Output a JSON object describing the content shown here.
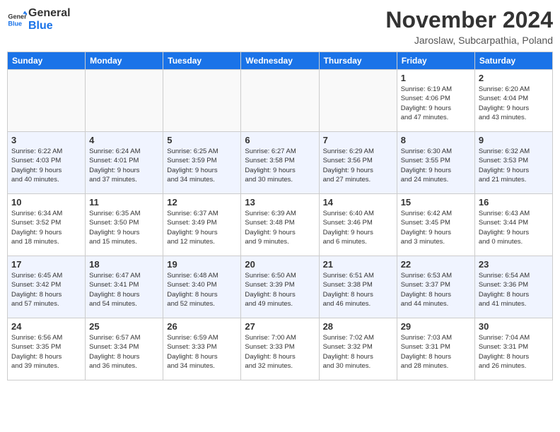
{
  "header": {
    "logo_line1": "General",
    "logo_line2": "Blue",
    "month": "November 2024",
    "location": "Jaroslaw, Subcarpathia, Poland"
  },
  "weekdays": [
    "Sunday",
    "Monday",
    "Tuesday",
    "Wednesday",
    "Thursday",
    "Friday",
    "Saturday"
  ],
  "weeks": [
    {
      "alt": false,
      "days": [
        {
          "num": "",
          "info": ""
        },
        {
          "num": "",
          "info": ""
        },
        {
          "num": "",
          "info": ""
        },
        {
          "num": "",
          "info": ""
        },
        {
          "num": "",
          "info": ""
        },
        {
          "num": "1",
          "info": "Sunrise: 6:19 AM\nSunset: 4:06 PM\nDaylight: 9 hours\nand 47 minutes."
        },
        {
          "num": "2",
          "info": "Sunrise: 6:20 AM\nSunset: 4:04 PM\nDaylight: 9 hours\nand 43 minutes."
        }
      ]
    },
    {
      "alt": true,
      "days": [
        {
          "num": "3",
          "info": "Sunrise: 6:22 AM\nSunset: 4:03 PM\nDaylight: 9 hours\nand 40 minutes."
        },
        {
          "num": "4",
          "info": "Sunrise: 6:24 AM\nSunset: 4:01 PM\nDaylight: 9 hours\nand 37 minutes."
        },
        {
          "num": "5",
          "info": "Sunrise: 6:25 AM\nSunset: 3:59 PM\nDaylight: 9 hours\nand 34 minutes."
        },
        {
          "num": "6",
          "info": "Sunrise: 6:27 AM\nSunset: 3:58 PM\nDaylight: 9 hours\nand 30 minutes."
        },
        {
          "num": "7",
          "info": "Sunrise: 6:29 AM\nSunset: 3:56 PM\nDaylight: 9 hours\nand 27 minutes."
        },
        {
          "num": "8",
          "info": "Sunrise: 6:30 AM\nSunset: 3:55 PM\nDaylight: 9 hours\nand 24 minutes."
        },
        {
          "num": "9",
          "info": "Sunrise: 6:32 AM\nSunset: 3:53 PM\nDaylight: 9 hours\nand 21 minutes."
        }
      ]
    },
    {
      "alt": false,
      "days": [
        {
          "num": "10",
          "info": "Sunrise: 6:34 AM\nSunset: 3:52 PM\nDaylight: 9 hours\nand 18 minutes."
        },
        {
          "num": "11",
          "info": "Sunrise: 6:35 AM\nSunset: 3:50 PM\nDaylight: 9 hours\nand 15 minutes."
        },
        {
          "num": "12",
          "info": "Sunrise: 6:37 AM\nSunset: 3:49 PM\nDaylight: 9 hours\nand 12 minutes."
        },
        {
          "num": "13",
          "info": "Sunrise: 6:39 AM\nSunset: 3:48 PM\nDaylight: 9 hours\nand 9 minutes."
        },
        {
          "num": "14",
          "info": "Sunrise: 6:40 AM\nSunset: 3:46 PM\nDaylight: 9 hours\nand 6 minutes."
        },
        {
          "num": "15",
          "info": "Sunrise: 6:42 AM\nSunset: 3:45 PM\nDaylight: 9 hours\nand 3 minutes."
        },
        {
          "num": "16",
          "info": "Sunrise: 6:43 AM\nSunset: 3:44 PM\nDaylight: 9 hours\nand 0 minutes."
        }
      ]
    },
    {
      "alt": true,
      "days": [
        {
          "num": "17",
          "info": "Sunrise: 6:45 AM\nSunset: 3:42 PM\nDaylight: 8 hours\nand 57 minutes."
        },
        {
          "num": "18",
          "info": "Sunrise: 6:47 AM\nSunset: 3:41 PM\nDaylight: 8 hours\nand 54 minutes."
        },
        {
          "num": "19",
          "info": "Sunrise: 6:48 AM\nSunset: 3:40 PM\nDaylight: 8 hours\nand 52 minutes."
        },
        {
          "num": "20",
          "info": "Sunrise: 6:50 AM\nSunset: 3:39 PM\nDaylight: 8 hours\nand 49 minutes."
        },
        {
          "num": "21",
          "info": "Sunrise: 6:51 AM\nSunset: 3:38 PM\nDaylight: 8 hours\nand 46 minutes."
        },
        {
          "num": "22",
          "info": "Sunrise: 6:53 AM\nSunset: 3:37 PM\nDaylight: 8 hours\nand 44 minutes."
        },
        {
          "num": "23",
          "info": "Sunrise: 6:54 AM\nSunset: 3:36 PM\nDaylight: 8 hours\nand 41 minutes."
        }
      ]
    },
    {
      "alt": false,
      "days": [
        {
          "num": "24",
          "info": "Sunrise: 6:56 AM\nSunset: 3:35 PM\nDaylight: 8 hours\nand 39 minutes."
        },
        {
          "num": "25",
          "info": "Sunrise: 6:57 AM\nSunset: 3:34 PM\nDaylight: 8 hours\nand 36 minutes."
        },
        {
          "num": "26",
          "info": "Sunrise: 6:59 AM\nSunset: 3:33 PM\nDaylight: 8 hours\nand 34 minutes."
        },
        {
          "num": "27",
          "info": "Sunrise: 7:00 AM\nSunset: 3:33 PM\nDaylight: 8 hours\nand 32 minutes."
        },
        {
          "num": "28",
          "info": "Sunrise: 7:02 AM\nSunset: 3:32 PM\nDaylight: 8 hours\nand 30 minutes."
        },
        {
          "num": "29",
          "info": "Sunrise: 7:03 AM\nSunset: 3:31 PM\nDaylight: 8 hours\nand 28 minutes."
        },
        {
          "num": "30",
          "info": "Sunrise: 7:04 AM\nSunset: 3:31 PM\nDaylight: 8 hours\nand 26 minutes."
        }
      ]
    }
  ]
}
